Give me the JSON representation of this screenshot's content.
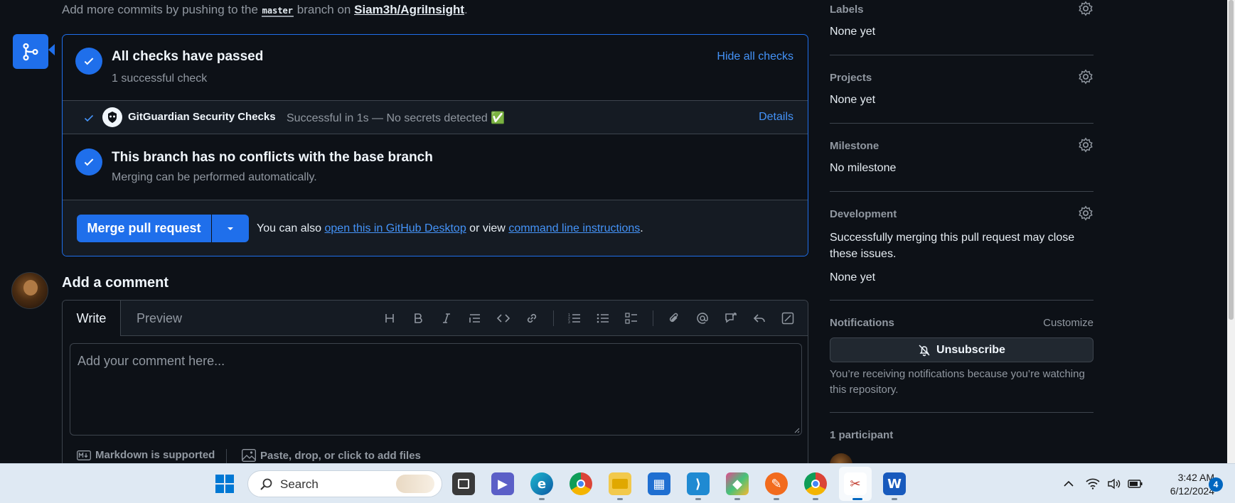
{
  "top": {
    "prefix": "Add more commits by pushing to the",
    "branch": "master",
    "middle": "branch on",
    "repo": "Siam3h/AgriInsight",
    "suffix": "."
  },
  "checks": {
    "title": "All checks have passed",
    "subtitle": "1 successful check",
    "hide_label": "Hide all checks",
    "row": {
      "name": "GitGuardian Security Checks",
      "description": "Successful in 1s — No secrets detected ✅",
      "details_label": "Details"
    }
  },
  "conflicts": {
    "title": "This branch has no conflicts with the base branch",
    "subtitle": "Merging can be performed automatically."
  },
  "merge": {
    "button_label": "Merge pull request",
    "also_prefix": "You can also",
    "desktop_link": "open this in GitHub Desktop",
    "or_view": "or view",
    "cli_link": "command line instructions",
    "suffix": "."
  },
  "comment": {
    "heading": "Add a comment",
    "tab_write": "Write",
    "tab_preview": "Preview",
    "placeholder": "Add your comment here...",
    "markdown_note": "Markdown is supported",
    "attach_note": "Paste, drop, or click to add files"
  },
  "sidebar": {
    "labels": {
      "heading": "Labels",
      "value": "None yet"
    },
    "projects": {
      "heading": "Projects",
      "value": "None yet"
    },
    "milestone": {
      "heading": "Milestone",
      "value": "No milestone"
    },
    "development": {
      "heading": "Development",
      "note": "Successfully merging this pull request may close these issues.",
      "value": "None yet"
    },
    "notifications": {
      "heading": "Notifications",
      "customize": "Customize",
      "unsubscribe": "Unsubscribe",
      "note": "You’re receiving notifications because you’re watching this repository."
    },
    "participants": {
      "heading": "1 participant"
    }
  },
  "taskbar": {
    "search_label": "Search",
    "time": "3:42 AM",
    "date": "6/12/2024",
    "notification_count": "4"
  },
  "colors": {
    "accent": "#1f6feb",
    "link": "#4493f8",
    "background": "#0d1117",
    "success_check": "#2da44e"
  }
}
